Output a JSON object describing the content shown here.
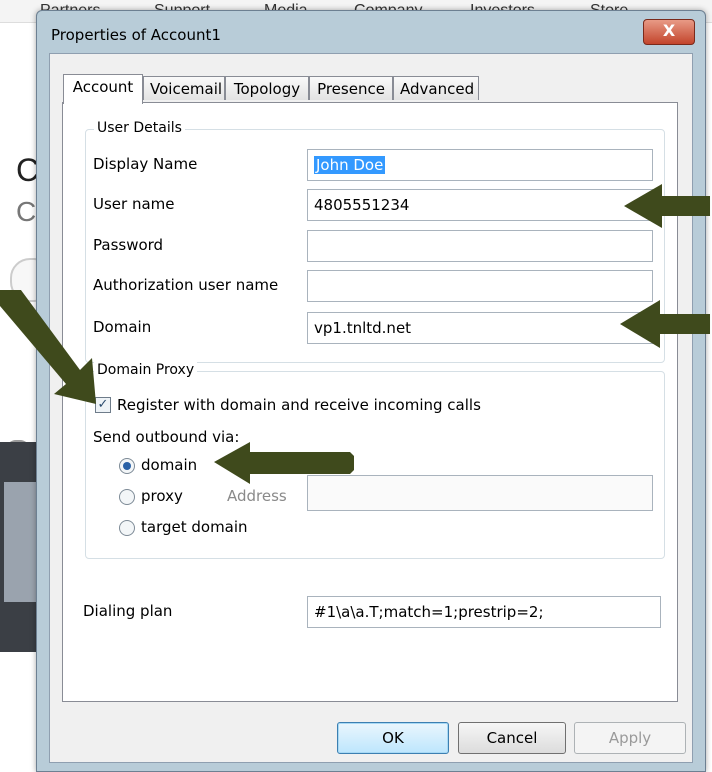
{
  "background_site": {
    "nav_items": [
      "Partners",
      "Support",
      "Media",
      "Company",
      "Investors",
      "Store"
    ],
    "big_letter_1": "C",
    "big_letter_2": "C"
  },
  "dialog": {
    "title": "Properties of Account1",
    "close_label": "X"
  },
  "tabs": [
    {
      "label": "Account",
      "active": true
    },
    {
      "label": "Voicemail",
      "active": false
    },
    {
      "label": "Topology",
      "active": false
    },
    {
      "label": "Presence",
      "active": false
    },
    {
      "label": "Advanced",
      "active": false
    }
  ],
  "user_details": {
    "title": "User Details",
    "display_name_label": "Display Name",
    "display_name_value": "John Doe",
    "user_name_label": "User name",
    "user_name_value": "4805551234",
    "password_label": "Password",
    "password_value": "",
    "auth_user_label": "Authorization user name",
    "auth_user_value": "",
    "domain_label": "Domain",
    "domain_value": "vp1.tnltd.net"
  },
  "domain_proxy": {
    "title": "Domain Proxy",
    "register_label": "Register with domain and receive incoming calls",
    "register_checked": true,
    "send_outbound_label": "Send outbound via:",
    "options": [
      {
        "label": "domain",
        "selected": true
      },
      {
        "label": "proxy",
        "selected": false
      },
      {
        "label": "target domain",
        "selected": false
      }
    ],
    "address_label": "Address",
    "address_value": ""
  },
  "dialing": {
    "label": "Dialing plan",
    "value": "#1\\a\\a.T;match=1;prestrip=2;"
  },
  "buttons": {
    "ok": "OK",
    "cancel": "Cancel",
    "apply": "Apply"
  },
  "colors": {
    "arrow": "#3f4a1c",
    "selection": "#3399ff",
    "close": "#c3452c"
  }
}
